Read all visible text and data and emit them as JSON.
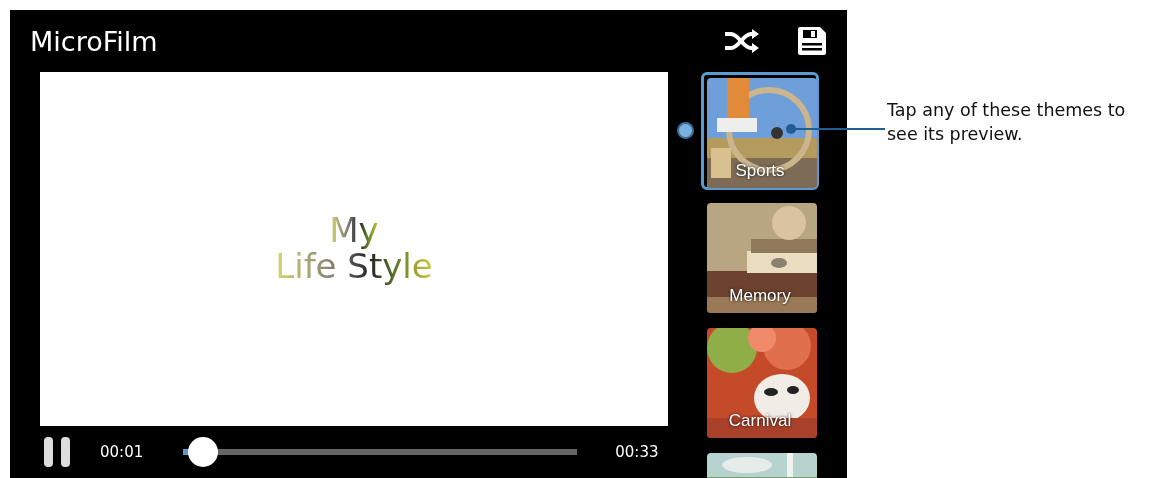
{
  "app": {
    "title": "MicroFilm"
  },
  "preview": {
    "title_lines": [
      "My",
      "Life Style"
    ]
  },
  "player": {
    "playing": true,
    "elapsed": "00:01",
    "duration": "00:33",
    "level": 0.05
  },
  "themes": [
    {
      "label": "Sports",
      "selected": true,
      "kind": "sports"
    },
    {
      "label": "Memory",
      "selected": false,
      "kind": "memory"
    },
    {
      "label": "Carnival",
      "selected": false,
      "kind": "carnival"
    },
    {
      "selected": false,
      "kind": "town"
    }
  ],
  "callout": {
    "text": "Tap any of these themes to see its preview."
  }
}
